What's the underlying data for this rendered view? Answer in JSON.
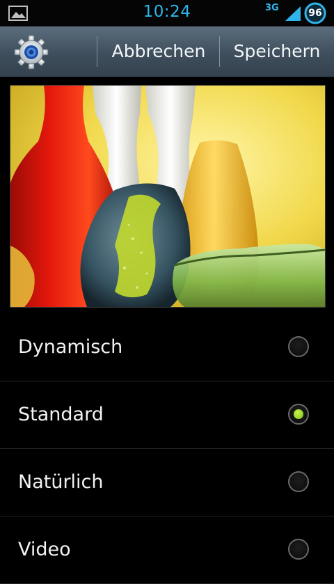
{
  "status_bar": {
    "time": "10:24",
    "network": "3G",
    "battery_level": "96",
    "icons": [
      "gallery-icon",
      "signal-icon",
      "battery-icon"
    ]
  },
  "action_bar": {
    "settings_icon": "gear-icon",
    "cancel_label": "Abbrechen",
    "save_label": "Speichern"
  },
  "preview": {
    "image": "glass-vases-photo"
  },
  "options": [
    {
      "label": "Dynamisch",
      "selected": false
    },
    {
      "label": "Standard",
      "selected": true
    },
    {
      "label": "Natürlich",
      "selected": false
    },
    {
      "label": "Video",
      "selected": false
    }
  ],
  "colors": {
    "accent": "#2fb5ea",
    "radio_selected": "#9bdc2a",
    "actionbar": "#465665"
  }
}
